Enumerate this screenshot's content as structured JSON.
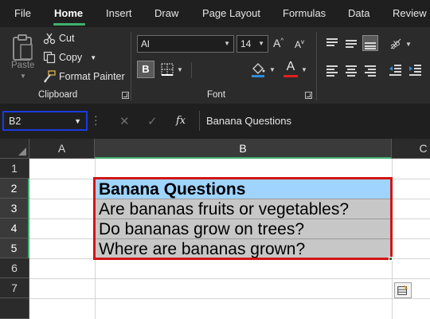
{
  "menu": {
    "items": [
      "File",
      "Home",
      "Insert",
      "Draw",
      "Page Layout",
      "Formulas",
      "Data",
      "Review"
    ],
    "active": "Home"
  },
  "clipboard": {
    "paste_label": "Paste",
    "cut_label": "Cut",
    "copy_label": "Copy",
    "format_painter_label": "Format Painter",
    "group_label": "Clipboard"
  },
  "font": {
    "font_name": "Al",
    "font_size": "14",
    "bold_label": "B",
    "font_color_label": "A",
    "group_label": "Font",
    "font_color": "#e02020",
    "fill_color": "#2f8bd8"
  },
  "formula_bar": {
    "name_box": "B2",
    "fx_label": "fx",
    "formula": "Banana Questions"
  },
  "grid": {
    "columns": [
      "A",
      "B",
      "C"
    ],
    "selected_column": "B",
    "rows": [
      "1",
      "2",
      "3",
      "4",
      "5",
      "6",
      "7"
    ],
    "selected_rows": [
      "2",
      "3",
      "4",
      "5"
    ],
    "cells": [
      "Banana Questions",
      "Are bananas fruits or vegetables?",
      "Do bananas grow on trees?",
      "Where are bananas grown?"
    ]
  },
  "colors": {
    "accent": "#3fb06e",
    "header_fill": "#9fd4ff",
    "body_fill": "#c7c7c7",
    "selection_outline": "#d21515",
    "namebox_outline": "#1a3be0"
  }
}
